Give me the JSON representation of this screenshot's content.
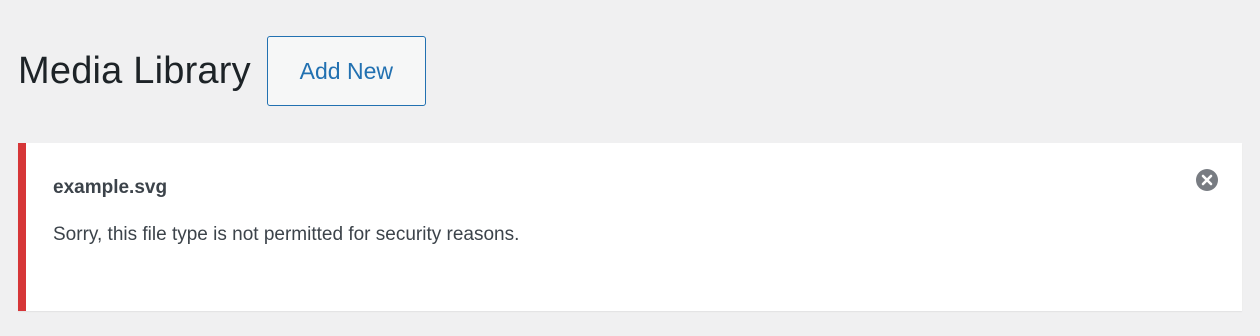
{
  "header": {
    "title": "Media Library",
    "add_new_label": "Add New"
  },
  "notice": {
    "filename": "example.svg",
    "message": "Sorry, this file type is not permitted for security reasons.",
    "dismiss_icon": "close-circle-icon",
    "accent_color": "#d63638"
  },
  "colors": {
    "background": "#f0f0f1",
    "link": "#2271b1",
    "text": "#1d2327"
  }
}
